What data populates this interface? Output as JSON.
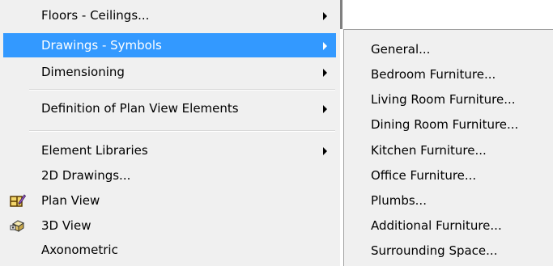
{
  "main_menu": {
    "items": [
      {
        "label": "Floors - Ceilings...",
        "submenu": true
      },
      {
        "label": "Drawings - Symbols",
        "submenu": true,
        "selected": true
      },
      {
        "label": "Dimensioning",
        "submenu": true
      },
      {
        "label": "Definition of Plan View Elements",
        "submenu": true
      },
      {
        "label": "Element Libraries",
        "submenu": true
      },
      {
        "label": "2D Drawings..."
      },
      {
        "label": "Plan View",
        "icon": "plan-view-icon"
      },
      {
        "label": "3D View",
        "icon": "3d-view-icon"
      },
      {
        "label": "Axonometric"
      }
    ]
  },
  "submenu": {
    "items": [
      {
        "label": "General..."
      },
      {
        "label": "Bedroom Furniture..."
      },
      {
        "label": "Living Room Furniture..."
      },
      {
        "label": "Dining Room Furniture..."
      },
      {
        "label": "Kitchen Furniture..."
      },
      {
        "label": "Office Furniture..."
      },
      {
        "label": "Plumbs..."
      },
      {
        "label": "Additional Furniture..."
      },
      {
        "label": "Surrounding Space..."
      }
    ]
  },
  "colors": {
    "menu_background": "#f0f0f0",
    "selection_highlight": "#3399ff",
    "selection_text": "#ffffff",
    "text": "#000000"
  }
}
